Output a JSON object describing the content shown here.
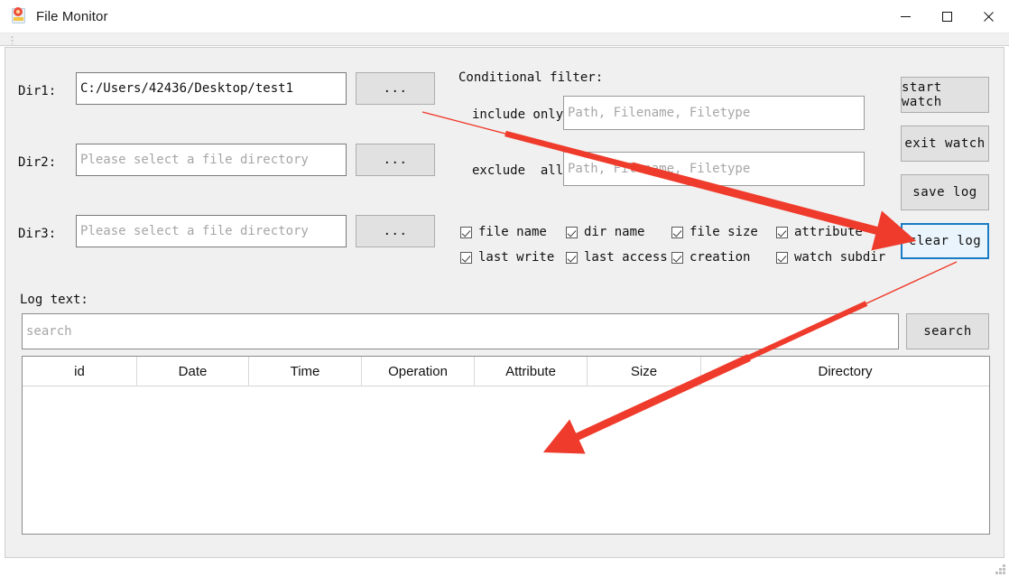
{
  "window": {
    "title": "File Monitor",
    "icon": "file-monitor-icon",
    "minimize": "minimize-icon",
    "maximize": "maximize-icon",
    "close": "close-icon"
  },
  "dirs": [
    {
      "label": "Dir1:",
      "value": "C:/Users/42436/Desktop/test1",
      "placeholder": "Please select a file directory",
      "browse": "..."
    },
    {
      "label": "Dir2:",
      "value": "",
      "placeholder": "Please select a file directory",
      "browse": "..."
    },
    {
      "label": "Dir3:",
      "value": "",
      "placeholder": "Please select a file directory",
      "browse": "..."
    }
  ],
  "filter": {
    "title": "Conditional filter:",
    "include_label": "include only",
    "include_value": "",
    "include_placeholder": "Path, Filename, Filetype",
    "exclude_label": "exclude  all",
    "exclude_value": "",
    "exclude_placeholder": "Path, Filename, Filetype"
  },
  "checkboxes": [
    {
      "label": "file name",
      "checked": true
    },
    {
      "label": "dir name",
      "checked": true
    },
    {
      "label": "file size",
      "checked": true
    },
    {
      "label": "attribute",
      "checked": true
    },
    {
      "label": "last write",
      "checked": true
    },
    {
      "label": "last access",
      "checked": true
    },
    {
      "label": "creation",
      "checked": true
    },
    {
      "label": "watch subdir",
      "checked": true
    }
  ],
  "actions": [
    {
      "label": "start watch",
      "focused": false
    },
    {
      "label": "exit watch",
      "focused": false
    },
    {
      "label": "save log",
      "focused": false
    },
    {
      "label": "clear log",
      "focused": true
    }
  ],
  "log": {
    "title": "Log text:",
    "search_value": "",
    "search_placeholder": "search",
    "search_button": "search"
  },
  "table": {
    "columns": [
      "id",
      "Date",
      "Time",
      "Operation",
      "Attribute",
      "Size",
      "Directory"
    ],
    "rows": []
  },
  "colors": {
    "focus_border": "#1a7cc4",
    "focus_fill": "#e9f4fc",
    "annotation": "#ef3b2c",
    "panel_bg": "#f0f0f0"
  },
  "annotations": [
    {
      "name": "arrow-to-clear-log",
      "from": "include only field",
      "to": "clear log button"
    },
    {
      "name": "arrow-to-log-table",
      "from": "clear log button",
      "to": "log table"
    }
  ]
}
